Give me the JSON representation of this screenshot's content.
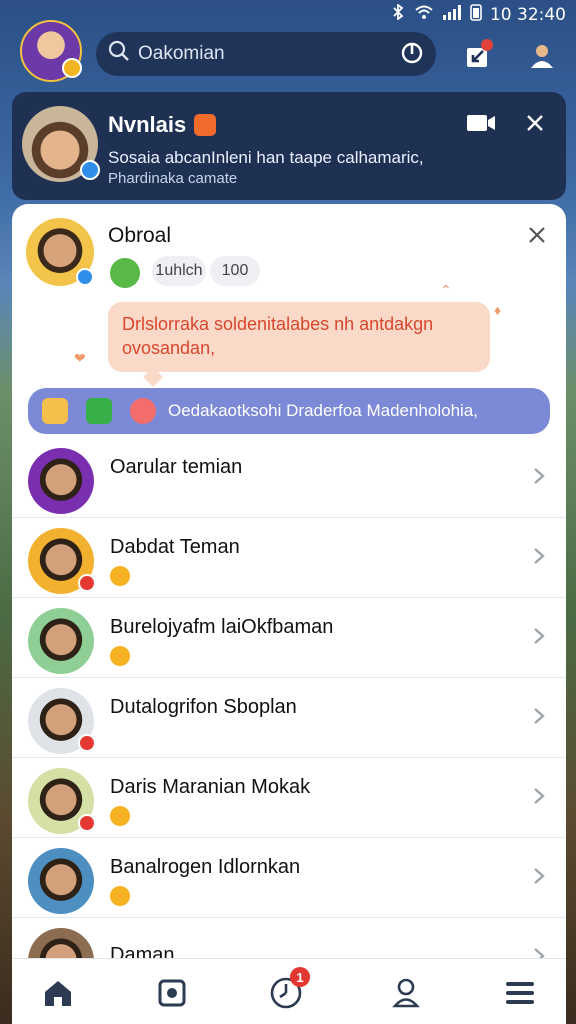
{
  "status_bar": {
    "time": "10 32:40"
  },
  "search": {
    "placeholder": "Oakomian"
  },
  "call_card": {
    "name": "Nvnlais",
    "message": "Sosaia abcanInleni han taape calhamaric,",
    "subtitle": "Phardinaka camate"
  },
  "chat": {
    "title": "Obroal",
    "chips": [
      "1uhlch",
      "100"
    ],
    "bubble_text": "Drlslorraka soldenitalabes nh antdakgn ovosandan,",
    "action_text": "Oedakaotksohi Draderfoa Madenholohia,"
  },
  "contacts": [
    {
      "name": "Oarular temian",
      "has_emoji": false,
      "badge": false,
      "avatar_bg": "#7a2fb0"
    },
    {
      "name": "Dabdat Teman",
      "has_emoji": true,
      "badge": true,
      "avatar_bg": "#f2b230"
    },
    {
      "name": "Burelojyafm laiOkfbaman",
      "has_emoji": true,
      "badge": false,
      "avatar_bg": "#8fcf96"
    },
    {
      "name": "Dutalogrifon Sboplan",
      "has_emoji": false,
      "badge": true,
      "avatar_bg": "#dfe3e8"
    },
    {
      "name": "Daris Maranian Mokak",
      "has_emoji": true,
      "badge": true,
      "avatar_bg": "#d5e0a6"
    },
    {
      "name": "Banalrogen Idlornkan",
      "has_emoji": true,
      "badge": false,
      "avatar_bg": "#4e8fc1"
    },
    {
      "name": "Daman",
      "has_emoji": false,
      "badge": false,
      "avatar_bg": "#8d6d52"
    }
  ],
  "nav": {
    "timer_badge": "1"
  },
  "colors": {
    "accent": "#7b89d6",
    "bubble": "#fbd9c9",
    "badge_red": "#e2382f"
  }
}
